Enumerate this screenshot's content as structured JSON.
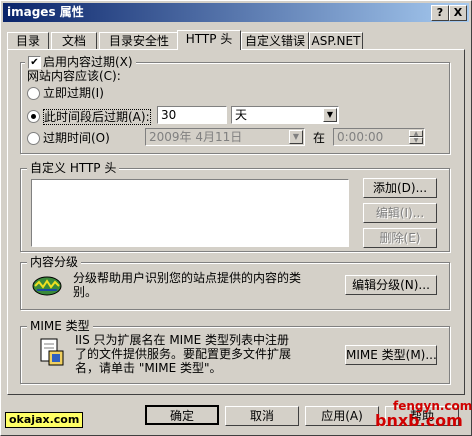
{
  "window": {
    "title": "images 属性",
    "help_btn": "?",
    "close_btn": "X"
  },
  "tabs": [
    "目录",
    "文档",
    "目录安全性",
    "HTTP 头",
    "自定义错误",
    "ASP.NET"
  ],
  "content_expire": {
    "group_label": "启用内容过期(X)",
    "checked": true,
    "should_label": "网站内容应该(C):",
    "opt_now": "立即过期(I)",
    "opt_after": "此时间段后过期(A):",
    "after_value": "30",
    "after_unit": "天",
    "opt_at": "过期时间(O)",
    "date_value": "2009年 4月11日",
    "at_label": "在",
    "time_value": "0:00:00"
  },
  "custom_http": {
    "group_label": "自定义 HTTP 头",
    "add": "添加(D)...",
    "edit": "编辑(I)...",
    "delete": "删除(E)"
  },
  "rating": {
    "group_label": "内容分级",
    "desc": "分级帮助用户识别您的站点提供的内容的类别。",
    "edit": "编辑分级(N)..."
  },
  "mime": {
    "group_label": "MIME 类型",
    "desc_line1": "IIS 只为扩展名在 MIME 类型列表中注册",
    "desc_line2": "了的文件提供服务。要配置更多文件扩展",
    "desc_line3": "名，请单击 \"MIME 类型\"。",
    "button": "MIME 类型(M)..."
  },
  "footer": {
    "ok": "确定",
    "cancel": "取消",
    "apply": "应用(A)",
    "help": "帮助"
  },
  "watermarks": {
    "left": "okajax.com",
    "right_top": "fengyn.com",
    "right_bottom": "bnxb.com"
  }
}
